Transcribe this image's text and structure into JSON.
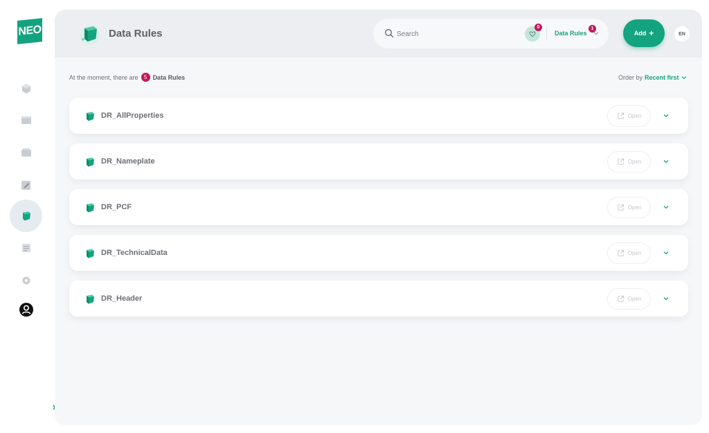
{
  "app": {
    "logo_text": "NEO",
    "accent_color": "#13a37f",
    "badge_color": "#c2185b"
  },
  "sidebar": {
    "items": [
      {
        "name": "cube-icon",
        "active": false
      },
      {
        "name": "folder-icon",
        "active": false
      },
      {
        "name": "stack-icon",
        "active": false
      },
      {
        "name": "edit-icon",
        "active": false
      },
      {
        "name": "data-rule-icon",
        "active": true
      },
      {
        "name": "document-list-icon",
        "active": false
      },
      {
        "name": "gear-icon",
        "active": false
      },
      {
        "name": "user-avatar-icon",
        "active": false
      }
    ],
    "expand_label": "»"
  },
  "header": {
    "title": "Data Rules",
    "search_placeholder": "Search",
    "favorites_count": "0",
    "scope_label": "Data Rules",
    "scope_count": "1",
    "add_label": "Add",
    "language": "EN"
  },
  "summary": {
    "prefix": "At the moment, there are",
    "count": "5",
    "suffix": "Data Rules",
    "order_label": "Order by",
    "order_value": "Recent first"
  },
  "rows": [
    {
      "name": "DR_AllProperties",
      "open_label": "Open"
    },
    {
      "name": "DR_Nameplate",
      "open_label": "Open"
    },
    {
      "name": "DR_PCF",
      "open_label": "Open"
    },
    {
      "name": "DR_TechnicalData",
      "open_label": "Open"
    },
    {
      "name": "DR_Header",
      "open_label": "Open"
    }
  ]
}
